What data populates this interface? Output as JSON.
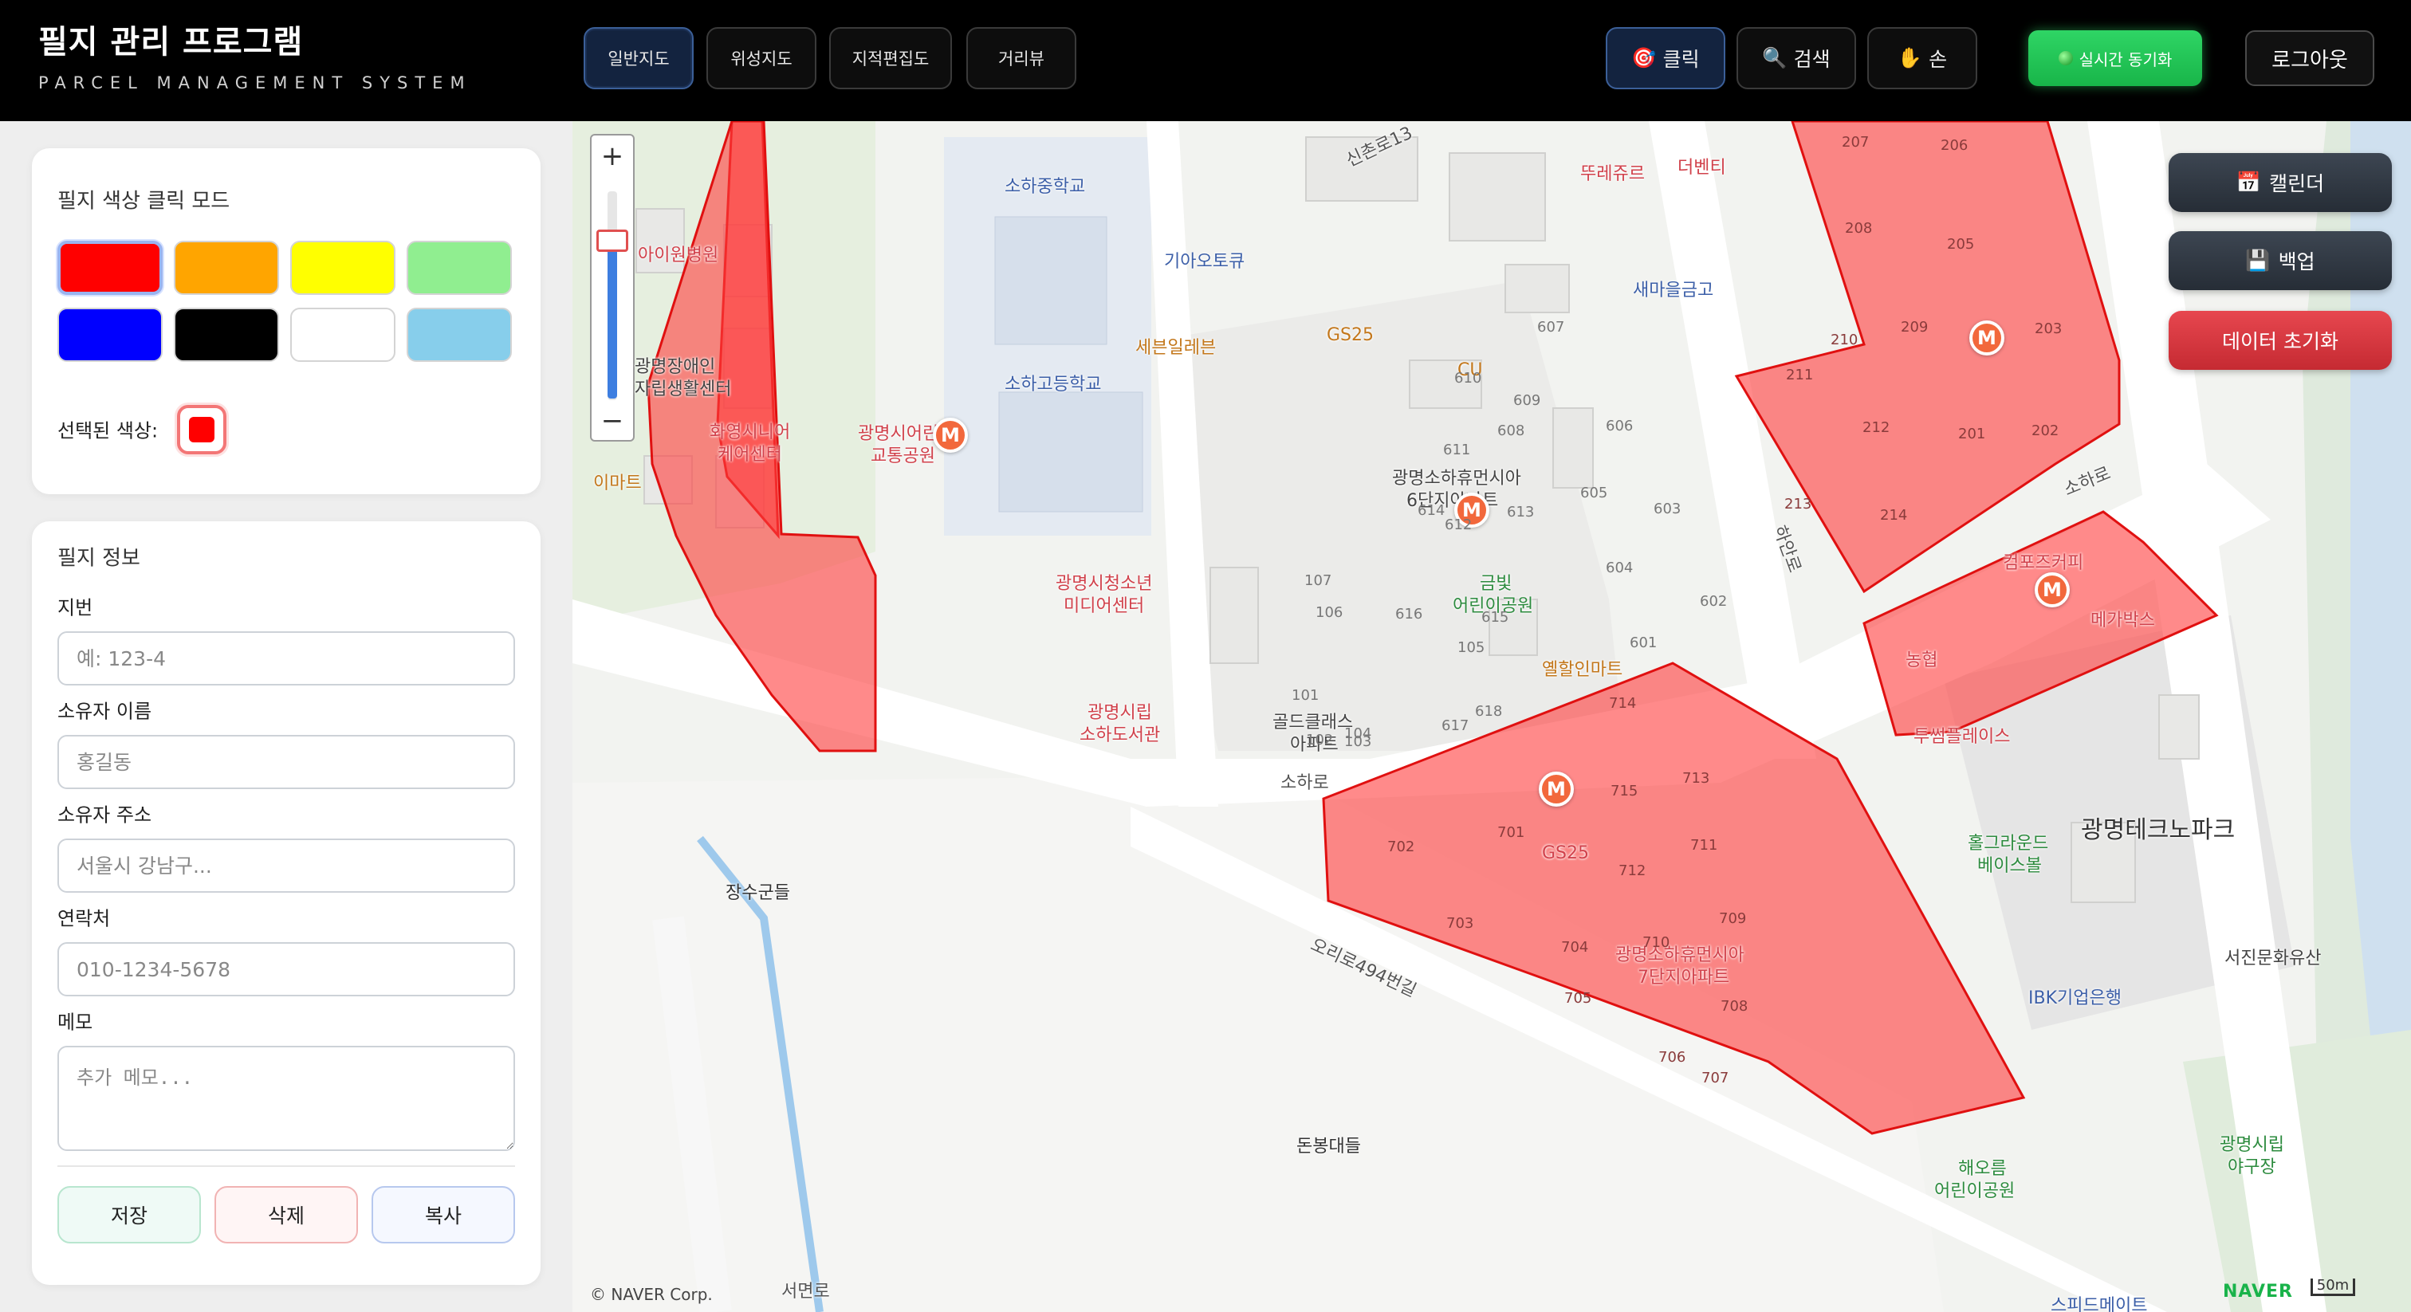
{
  "header": {
    "title": "필지 관리 프로그램",
    "subtitle": "PARCEL MANAGEMENT SYSTEM",
    "map_tabs": [
      "일반지도",
      "위성지도",
      "지적편집도",
      "거리뷰"
    ],
    "active_map_tab": "일반지도",
    "tools": [
      {
        "icon": "dart-icon",
        "glyph": "🎯",
        "label": "클릭"
      },
      {
        "icon": "magnifier-icon",
        "glyph": "🔍",
        "label": "검색"
      },
      {
        "icon": "hand-icon",
        "glyph": "✋",
        "label": "손"
      }
    ],
    "active_tool": "클릭",
    "sync_label": "실시간 동기화",
    "logout_label": "로그아웃"
  },
  "color_panel": {
    "title": "필지 색상 클릭 모드",
    "colors": [
      "#ff0000",
      "#ffa500",
      "#ffff00",
      "#90ee90",
      "#0000ff",
      "#000000",
      "#ffffff",
      "#87ceeb"
    ],
    "selected_color": "#ff0000",
    "selected_label": "선택된 색상:"
  },
  "parcel_info": {
    "title": "필지 정보",
    "fields": {
      "lot": {
        "label": "지번",
        "placeholder": "예: 123-4",
        "value": ""
      },
      "owner_name": {
        "label": "소유자 이름",
        "placeholder": "홍길동",
        "value": ""
      },
      "owner_address": {
        "label": "소유자 주소",
        "placeholder": "서울시 강남구...",
        "value": ""
      },
      "contact": {
        "label": "연락처",
        "placeholder": "010-1234-5678",
        "value": ""
      },
      "memo": {
        "label": "메모",
        "placeholder": "추가 메모...",
        "value": ""
      }
    },
    "buttons": {
      "save": "저장",
      "delete": "삭제",
      "copy": "복사"
    }
  },
  "map_side_buttons": {
    "calendar": {
      "glyph": "📅",
      "label": "캘린더"
    },
    "backup": {
      "glyph": "💾",
      "label": "백업"
    },
    "reset": {
      "label": "데이터 초기화"
    }
  },
  "map_labels": {
    "school_mid": "소하중학교",
    "school_high": "소하고등학교",
    "kia": "기아오토큐",
    "gs25_top": "GS25",
    "seven": "세븐일레븐",
    "cu": "CU",
    "tous": "뚜레쥬르",
    "venti": "더벤티",
    "saemaeul": "새마을금고",
    "child_hosp": "아이원병원",
    "disabled_center_1": "광명장애인",
    "disabled_center_2": "자립생활센터",
    "senior_1": "화영시니어",
    "senior_2": "케어센터",
    "emart": "이마트",
    "traffic_park_1": "광명시어린이",
    "traffic_park_2": "교통공원",
    "youth_1": "광명시청소년",
    "youth_2": "미디어센터",
    "library_1": "광명시립",
    "library_2": "소하도서관",
    "apt6_1": "광명소하휴먼시아",
    "apt6_2": "6단지아파트",
    "geumbit_1": "금빛",
    "geumbit_2": "어린이공원",
    "yellow_mart": "옐할인마트",
    "gold_1": "골드클래스",
    "gold_2": "아파트",
    "soha_road_1": "소하로",
    "soha_road_2": "소하로",
    "hain_road": "하안로",
    "gs25_low": "GS25",
    "apt7_1": "광명소하휴먼시아",
    "apt7_2": "7단지아파트",
    "compose": "컴포즈커피",
    "mega": "메가박스",
    "nonghyup": "농협",
    "twosome": "투썸플레이스",
    "techno": "광명테크노파크",
    "holla_1": "홀그라운드",
    "holla_2": "베이스볼",
    "seojin": "서진문화유산",
    "ibk": "IBK기업은행",
    "baseball_1": "광명시립",
    "baseball_2": "야구장",
    "haeoreum_1": "해오름",
    "haeoreum_2": "어린이공원",
    "jangsu": "장수군들",
    "donbong": "돈봉대들",
    "ori494": "오리로494번길",
    "seomyeon": "서면로",
    "sports_partial": "스피드메이트",
    "sinchon": "신촌로13",
    "copyright": "© NAVER Corp.",
    "naver": "NAVER",
    "scale": "50m"
  },
  "parcel_numbers": {
    "block_200": [
      "207",
      "206",
      "208",
      "205",
      "210",
      "209",
      "203",
      "211",
      "212",
      "201",
      "202",
      "213",
      "214"
    ],
    "block_600": [
      "607",
      "610",
      "609",
      "608",
      "611",
      "606",
      "605",
      "612",
      "613",
      "614",
      "603",
      "604",
      "107",
      "602",
      "106",
      "616",
      "615",
      "601",
      "105",
      "618",
      "617",
      "104",
      "101",
      "102",
      "103"
    ],
    "block_700": [
      "714",
      "715",
      "713",
      "701",
      "702",
      "711",
      "712",
      "703",
      "704",
      "710",
      "709",
      "705",
      "708",
      "706",
      "707"
    ]
  }
}
